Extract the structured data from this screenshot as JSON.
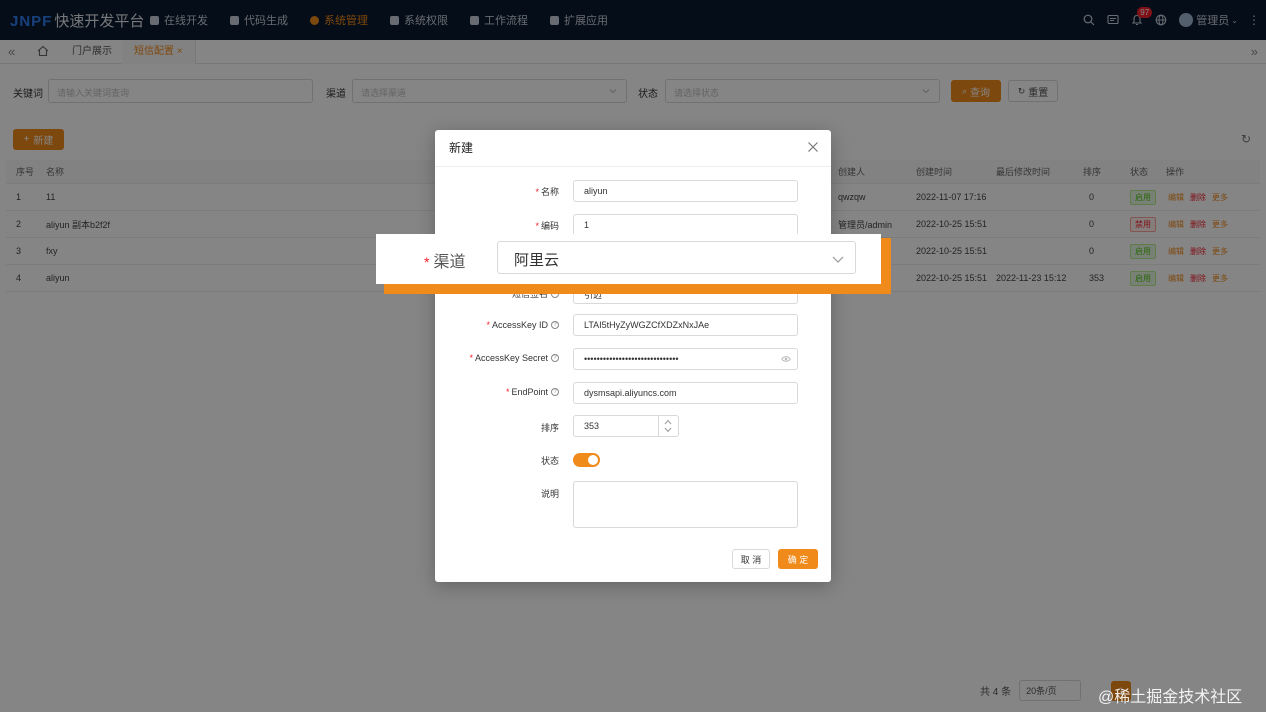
{
  "header": {
    "logo_mark": "JNPF",
    "logo_text": "快速开发平台",
    "nav": [
      {
        "label": "在线开发",
        "icon": "monitor-icon"
      },
      {
        "label": "代码生成",
        "icon": "code-icon"
      },
      {
        "label": "系统管理",
        "icon": "gear-icon"
      },
      {
        "label": "系统权限",
        "icon": "shield-icon"
      },
      {
        "label": "工作流程",
        "icon": "flow-icon"
      },
      {
        "label": "扩展应用",
        "icon": "apps-icon"
      }
    ],
    "active_nav": "系统管理",
    "notification_count": "97",
    "user_name": "管理员"
  },
  "tabs": {
    "items": [
      {
        "label": "门户展示"
      },
      {
        "label": "短信配置"
      }
    ],
    "active": "短信配置"
  },
  "search": {
    "keyword_label": "关键词",
    "keyword_placeholder": "请输入关键词查询",
    "channel_label": "渠道",
    "channel_placeholder": "请选择渠道",
    "status_label": "状态",
    "status_placeholder": "请选择状态",
    "query_button": "查询",
    "reset_button": "重置"
  },
  "toolbar": {
    "new_button": "新建"
  },
  "table": {
    "columns": [
      "序号",
      "名称",
      "创建人",
      "创建时间",
      "最后修改时间",
      "排序",
      "状态",
      "操作"
    ],
    "rows": [
      {
        "no": "1",
        "name": "11",
        "creator": "qwzqw",
        "created": "2022-11-07 17:16",
        "modified": "",
        "sort": "0",
        "status": "启用",
        "status_on": true
      },
      {
        "no": "2",
        "name": "aliyun 副本b2f2f",
        "creator": "管理员/admin",
        "created": "2022-10-25 15:51",
        "modified": "",
        "sort": "0",
        "status": "禁用",
        "status_on": false
      },
      {
        "no": "3",
        "name": "fxy",
        "creator": "",
        "created": "2022-10-25 15:51",
        "modified": "",
        "sort": "0",
        "status": "启用",
        "status_on": true
      },
      {
        "no": "4",
        "name": "aliyun",
        "creator": "",
        "created": "2022-10-25 15:51",
        "modified": "2022-11-23 15:12",
        "sort": "353",
        "status": "启用",
        "status_on": true
      }
    ],
    "ops": {
      "edit": "编辑",
      "delete": "删除",
      "more": "更多"
    }
  },
  "pagination": {
    "total": "共 4 条",
    "page_size": "20条/页",
    "current": "1"
  },
  "watermark": "@稀土掘金技术社区",
  "modal": {
    "title": "新建",
    "fields": {
      "name_label": "名称",
      "name_value": "aliyun",
      "code_label": "编码",
      "code_value": "1",
      "sign_label": "短信签名",
      "sign_value": "引迈",
      "akid_label": "AccessKey ID",
      "akid_value": "LTAI5tHyZyWGZCfXDZxNxJAe",
      "aksecret_label": "AccessKey Secret",
      "aksecret_value": "••••••••••••••••••••••••••••••",
      "endpoint_label": "EndPoint",
      "endpoint_value": "dysmsapi.aliyuncs.com",
      "sort_label": "排序",
      "sort_value": "353",
      "status_label": "状态",
      "status_enabled": true,
      "desc_label": "说明"
    },
    "cancel_button": "取 消",
    "confirm_button": "确 定"
  },
  "zoom": {
    "label": "渠道",
    "value": "阿里云"
  }
}
